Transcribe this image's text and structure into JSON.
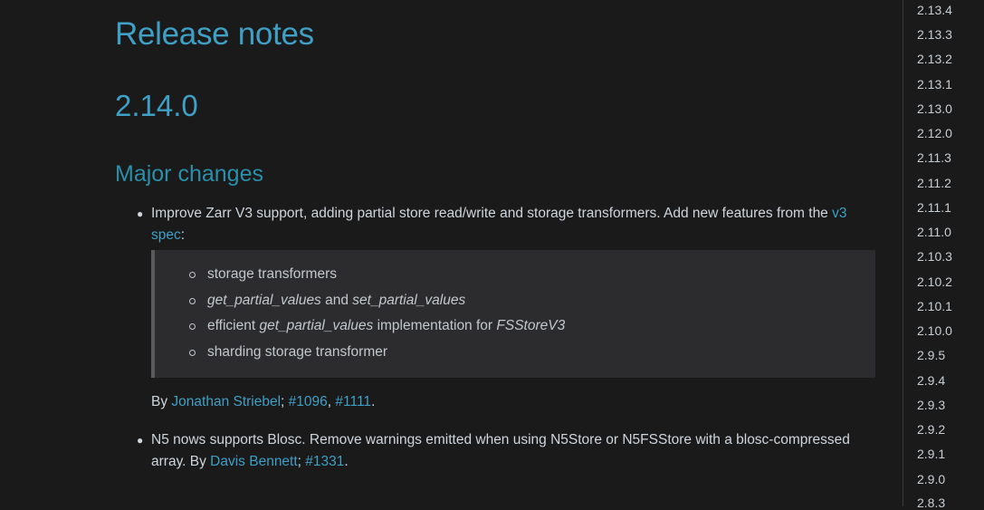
{
  "page": {
    "title": "Release notes",
    "version": "2.14.0",
    "section": "Major changes"
  },
  "item1": {
    "text_a": "Improve Zarr V3 support, adding partial store read/write and storage transformers. Add new features from the ",
    "link_a": "v3",
    "link_b": "spec",
    "text_b": ":",
    "subitems": {
      "s1": "storage transformers",
      "s2_a": "get_partial_values",
      "s2_b": " and ",
      "s2_c": "set_partial_values",
      "s3_a": "efficient ",
      "s3_b": "get_partial_values",
      "s3_c": " implementation for ",
      "s3_d": "FSStoreV3",
      "s4": "sharding storage transformer"
    },
    "by_prefix": "By ",
    "author": "Jonathan Striebel",
    "sep": "; ",
    "ref1": "#1096",
    "comma": ", ",
    "ref2": "#1111",
    "end": "."
  },
  "item2": {
    "text_a": "N5 nows supports Blosc. Remove warnings emitted when using N5Store or N5FSStore with a blosc-compressed",
    "text_b": "array. By ",
    "author": "Davis Bennett",
    "sep": "; ",
    "ref1": "#1331",
    "end": "."
  },
  "sidebar": {
    "versions": [
      "2.13.4",
      "2.13.3",
      "2.13.2",
      "2.13.1",
      "2.13.0",
      "2.12.0",
      "2.11.3",
      "2.11.2",
      "2.11.1",
      "2.11.0",
      "2.10.3",
      "2.10.2",
      "2.10.1",
      "2.10.0",
      "2.9.5",
      "2.9.4",
      "2.9.3",
      "2.9.2",
      "2.9.1",
      "2.9.0",
      "2.8.3"
    ]
  }
}
